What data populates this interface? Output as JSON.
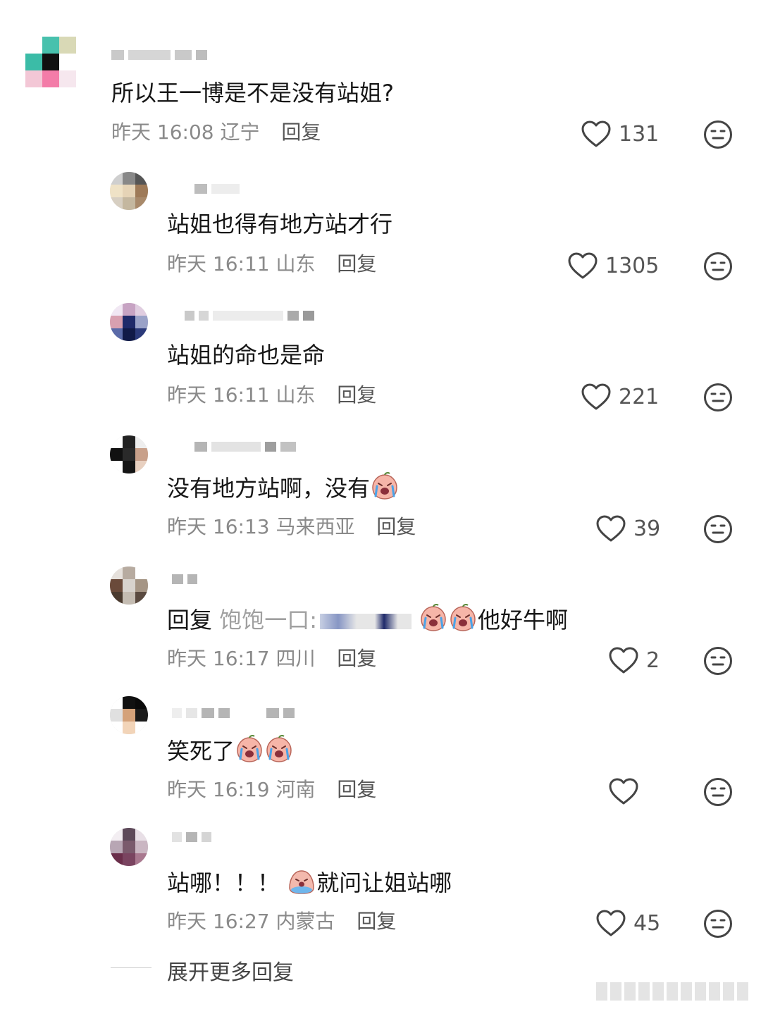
{
  "comments": [
    {
      "text": "所以王一博是不是没有站姐?",
      "time": "昨天 16:08",
      "location": "辽宁",
      "reply": "回复",
      "likes": "131"
    },
    {
      "text": "站姐也得有地方站才行",
      "time": "昨天 16:11",
      "location": "山东",
      "reply": "回复",
      "likes": "1305"
    },
    {
      "text": "站姐的命也是命",
      "time": "昨天 16:11",
      "location": "山东",
      "reply": "回复",
      "likes": "221"
    },
    {
      "text": "没有地方站啊，没有",
      "time": "昨天 16:13",
      "location": "马来西亚",
      "reply": "回复",
      "likes": "39"
    },
    {
      "reply_prefix": "回复",
      "quoted_user": "饱饱一口:",
      "text_tail": "他好牛啊",
      "time": "昨天 16:17",
      "location": "四川",
      "reply": "回复",
      "likes": "2"
    },
    {
      "text": "笑死了",
      "time": "昨天 16:19",
      "location": "河南",
      "reply": "回复",
      "likes": ""
    },
    {
      "text_head": "站哪！！！",
      "text_tail": "就问让姐站哪",
      "time": "昨天 16:27",
      "location": "内蒙古",
      "reply": "回复",
      "likes": "45"
    }
  ],
  "expand_label": "展开更多回复",
  "icons": {
    "like": "heart-outline-icon",
    "dislike": "meh-face-icon",
    "emoji": "crying-peach-emoji",
    "emoji2": "crying-blob-emoji"
  }
}
